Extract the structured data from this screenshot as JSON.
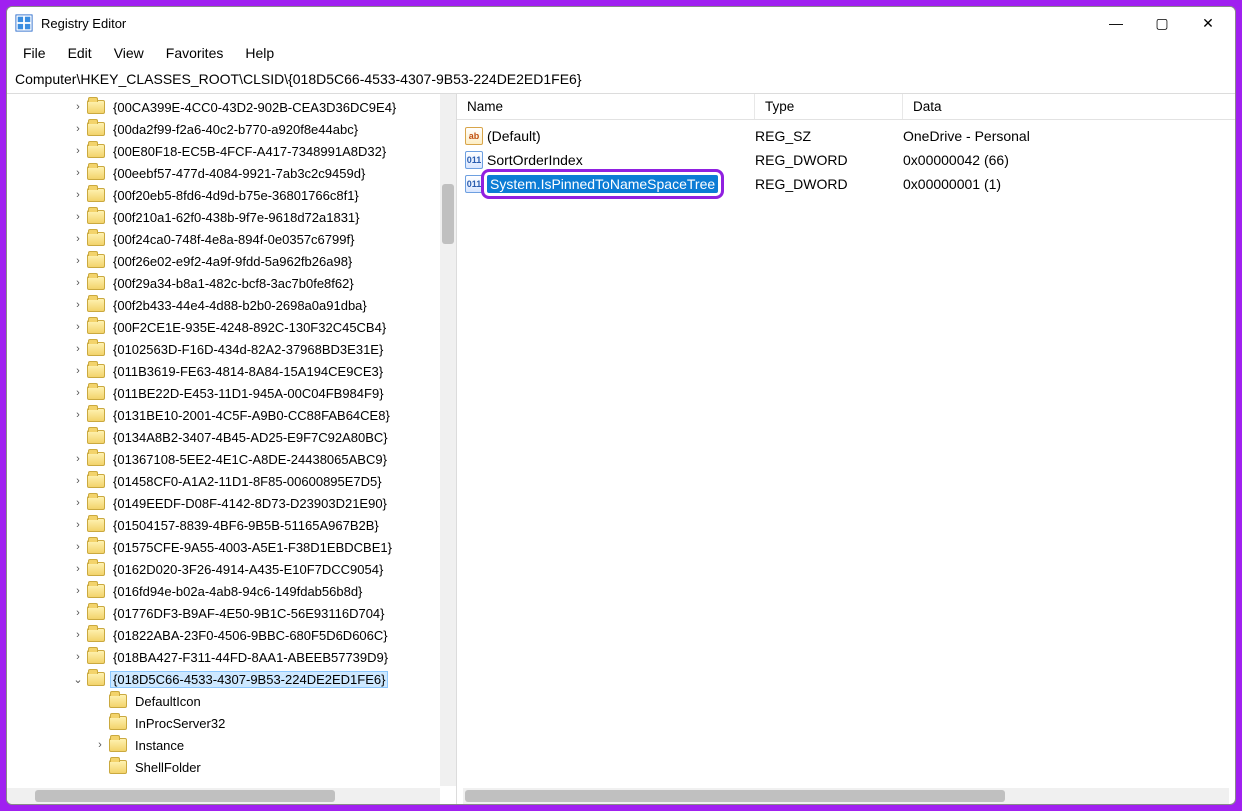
{
  "window": {
    "title": "Registry Editor"
  },
  "menu": {
    "file": "File",
    "edit": "Edit",
    "view": "View",
    "favorites": "Favorites",
    "help": "Help"
  },
  "address": "Computer\\HKEY_CLASSES_ROOT\\CLSID\\{018D5C66-4533-4307-9B53-224DE2ED1FE6}",
  "tree": [
    {
      "label": "{00CA399E-4CC0-43D2-902B-CEA3D36DC9E4}",
      "chevron": ">",
      "indent": 0
    },
    {
      "label": "{00da2f99-f2a6-40c2-b770-a920f8e44abc}",
      "chevron": ">",
      "indent": 0
    },
    {
      "label": "{00E80F18-EC5B-4FCF-A417-7348991A8D32}",
      "chevron": ">",
      "indent": 0
    },
    {
      "label": "{00eebf57-477d-4084-9921-7ab3c2c9459d}",
      "chevron": ">",
      "indent": 0
    },
    {
      "label": "{00f20eb5-8fd6-4d9d-b75e-36801766c8f1}",
      "chevron": ">",
      "indent": 0
    },
    {
      "label": "{00f210a1-62f0-438b-9f7e-9618d72a1831}",
      "chevron": ">",
      "indent": 0
    },
    {
      "label": "{00f24ca0-748f-4e8a-894f-0e0357c6799f}",
      "chevron": ">",
      "indent": 0
    },
    {
      "label": "{00f26e02-e9f2-4a9f-9fdd-5a962fb26a98}",
      "chevron": ">",
      "indent": 0
    },
    {
      "label": "{00f29a34-b8a1-482c-bcf8-3ac7b0fe8f62}",
      "chevron": ">",
      "indent": 0
    },
    {
      "label": "{00f2b433-44e4-4d88-b2b0-2698a0a91dba}",
      "chevron": ">",
      "indent": 0
    },
    {
      "label": "{00F2CE1E-935E-4248-892C-130F32C45CB4}",
      "chevron": ">",
      "indent": 0
    },
    {
      "label": "{0102563D-F16D-434d-82A2-37968BD3E31E}",
      "chevron": ">",
      "indent": 0
    },
    {
      "label": "{011B3619-FE63-4814-8A84-15A194CE9CE3}",
      "chevron": ">",
      "indent": 0
    },
    {
      "label": "{011BE22D-E453-11D1-945A-00C04FB984F9}",
      "chevron": ">",
      "indent": 0
    },
    {
      "label": "{0131BE10-2001-4C5F-A9B0-CC88FAB64CE8}",
      "chevron": ">",
      "indent": 0
    },
    {
      "label": "{0134A8B2-3407-4B45-AD25-E9F7C92A80BC}",
      "chevron": "",
      "indent": 0
    },
    {
      "label": "{01367108-5EE2-4E1C-A8DE-24438065ABC9}",
      "chevron": ">",
      "indent": 0
    },
    {
      "label": "{01458CF0-A1A2-11D1-8F85-00600895E7D5}",
      "chevron": ">",
      "indent": 0
    },
    {
      "label": "{0149EEDF-D08F-4142-8D73-D23903D21E90}",
      "chevron": ">",
      "indent": 0
    },
    {
      "label": "{01504157-8839-4BF6-9B5B-51165A967B2B}",
      "chevron": ">",
      "indent": 0
    },
    {
      "label": "{01575CFE-9A55-4003-A5E1-F38D1EBDCBE1}",
      "chevron": ">",
      "indent": 0
    },
    {
      "label": "{0162D020-3F26-4914-A435-E10F7DCC9054}",
      "chevron": ">",
      "indent": 0
    },
    {
      "label": "{016fd94e-b02a-4ab8-94c6-149fdab56b8d}",
      "chevron": ">",
      "indent": 0
    },
    {
      "label": "{01776DF3-B9AF-4E50-9B1C-56E93116D704}",
      "chevron": ">",
      "indent": 0
    },
    {
      "label": "{01822ABA-23F0-4506-9BBC-680F5D6D606C}",
      "chevron": ">",
      "indent": 0
    },
    {
      "label": "{018BA427-F311-44FD-8AA1-ABEEB57739D9}",
      "chevron": ">",
      "indent": 0
    },
    {
      "label": "{018D5C66-4533-4307-9B53-224DE2ED1FE6}",
      "chevron": "v",
      "indent": 0,
      "selected": true
    },
    {
      "label": "DefaultIcon",
      "chevron": "",
      "indent": 1
    },
    {
      "label": "InProcServer32",
      "chevron": "",
      "indent": 1
    },
    {
      "label": "Instance",
      "chevron": ">",
      "indent": 1
    },
    {
      "label": "ShellFolder",
      "chevron": "",
      "indent": 1
    }
  ],
  "columns": {
    "name": "Name",
    "type": "Type",
    "data": "Data"
  },
  "values": [
    {
      "name": "(Default)",
      "type": "REG_SZ",
      "data": "OneDrive - Personal",
      "icon": "sz",
      "selected": false,
      "highlight": false
    },
    {
      "name": "SortOrderIndex",
      "type": "REG_DWORD",
      "data": "0x00000042 (66)",
      "icon": "dw",
      "selected": false,
      "highlight": false
    },
    {
      "name": "System.IsPinnedToNameSpaceTree",
      "type": "REG_DWORD",
      "data": "0x00000001 (1)",
      "icon": "dw",
      "selected": true,
      "highlight": true
    }
  ],
  "winbuttons": {
    "min": "—",
    "max": "▢",
    "close": "✕"
  }
}
